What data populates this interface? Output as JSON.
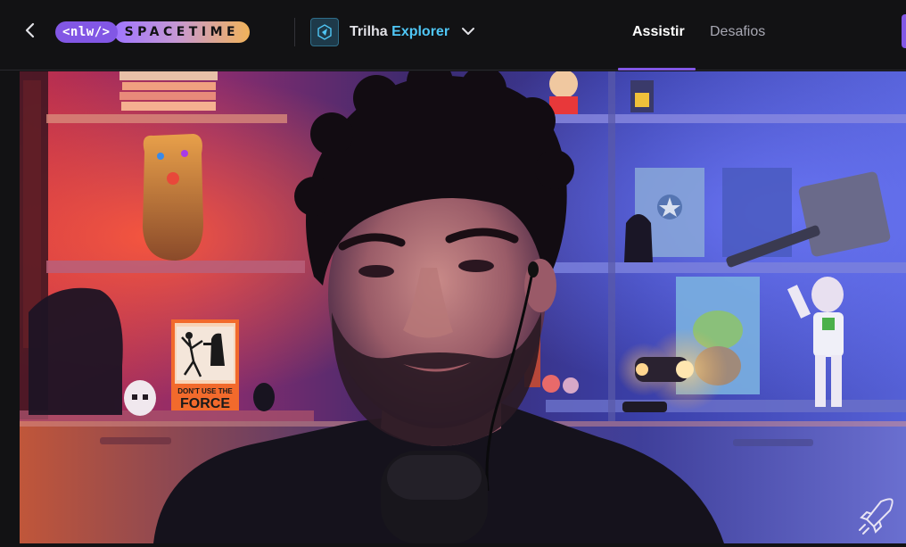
{
  "header": {
    "back_icon": "chevron-left-icon",
    "logo": {
      "nlw_text": "<nlw/>",
      "spacetime_text": "SPACETIME"
    },
    "track": {
      "icon": "explorer-track-icon",
      "prefix": "Trilha",
      "name": "Explorer",
      "dropdown_icon": "chevron-down-icon"
    },
    "tabs": [
      {
        "label": "Assistir",
        "active": true
      },
      {
        "label": "Desafios",
        "active": false
      }
    ]
  },
  "video": {
    "poster_text": {
      "line1": "DON'T USE THE",
      "line2": "FORCE"
    },
    "watermark_icon": "rocket-icon"
  },
  "colors": {
    "background": "#121214",
    "accent": "#8257e5",
    "explorer_blue": "#4fc6f5",
    "text_primary": "#e1e1e6",
    "text_muted": "#a8a8b3"
  }
}
